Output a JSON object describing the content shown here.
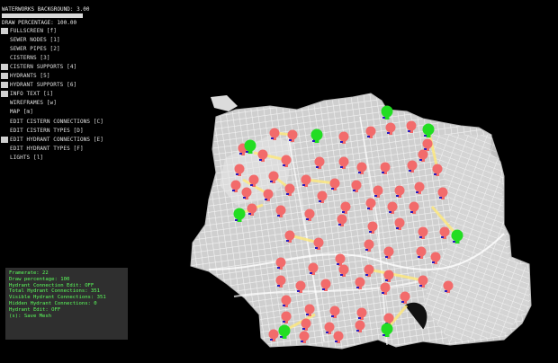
{
  "header": {
    "waterworks_background": "WATERWORKS BACKGROUND: 3.00",
    "draw_percentage": "DRAW PERCENTAGE: 100.00"
  },
  "menu": {
    "items": [
      {
        "label": "FULLSCREEN [f]",
        "checked": true
      },
      {
        "label": "SEWER NODES [1]",
        "checked": false
      },
      {
        "label": "SEWER PIPES [2]",
        "checked": false
      },
      {
        "label": "CISTERNS [3]",
        "checked": false
      },
      {
        "label": "CISTERN SUPPORTS [4]",
        "checked": true
      },
      {
        "label": "HYDRANTS [5]",
        "checked": true
      },
      {
        "label": "HYDRANT SUPPORTS [6]",
        "checked": true
      },
      {
        "label": "INFO TEXT [i]",
        "checked": true
      },
      {
        "label": "WIREFRAMES [w]",
        "checked": false
      },
      {
        "label": "MAP [m]",
        "checked": false
      },
      {
        "label": "EDIT CISTERN CONNECTIONS [C]",
        "checked": false
      },
      {
        "label": "EDIT CISTERN TYPES [D]",
        "checked": false
      },
      {
        "label": "EDIT HYDRANT CONNECTIONS [E]",
        "checked": true
      },
      {
        "label": "EDIT HYDRANT TYPES [F]",
        "checked": false
      },
      {
        "label": "LIGHTS [l]",
        "checked": false
      }
    ]
  },
  "info": {
    "lines": [
      "Framerate: 22",
      "Draw percentage: 100",
      "Hydrant Connection Edit: OFF",
      "Total Hydrant Connections: 351",
      "Visible Hydrant Connections: 351",
      "Hidden Hydrant Connections: 0",
      "Hydrant Edit: OFF",
      "(s): Save Mesh"
    ]
  },
  "colors": {
    "background": "#000000",
    "land": "#d8d8d8",
    "hydrant": "#f26b6b",
    "hydrant_marker": "#2a1bbd",
    "cistern": "#22dd22",
    "connection": "#ffe97a",
    "info_text": "#5cff5c",
    "panel": "#2f2f2f"
  }
}
